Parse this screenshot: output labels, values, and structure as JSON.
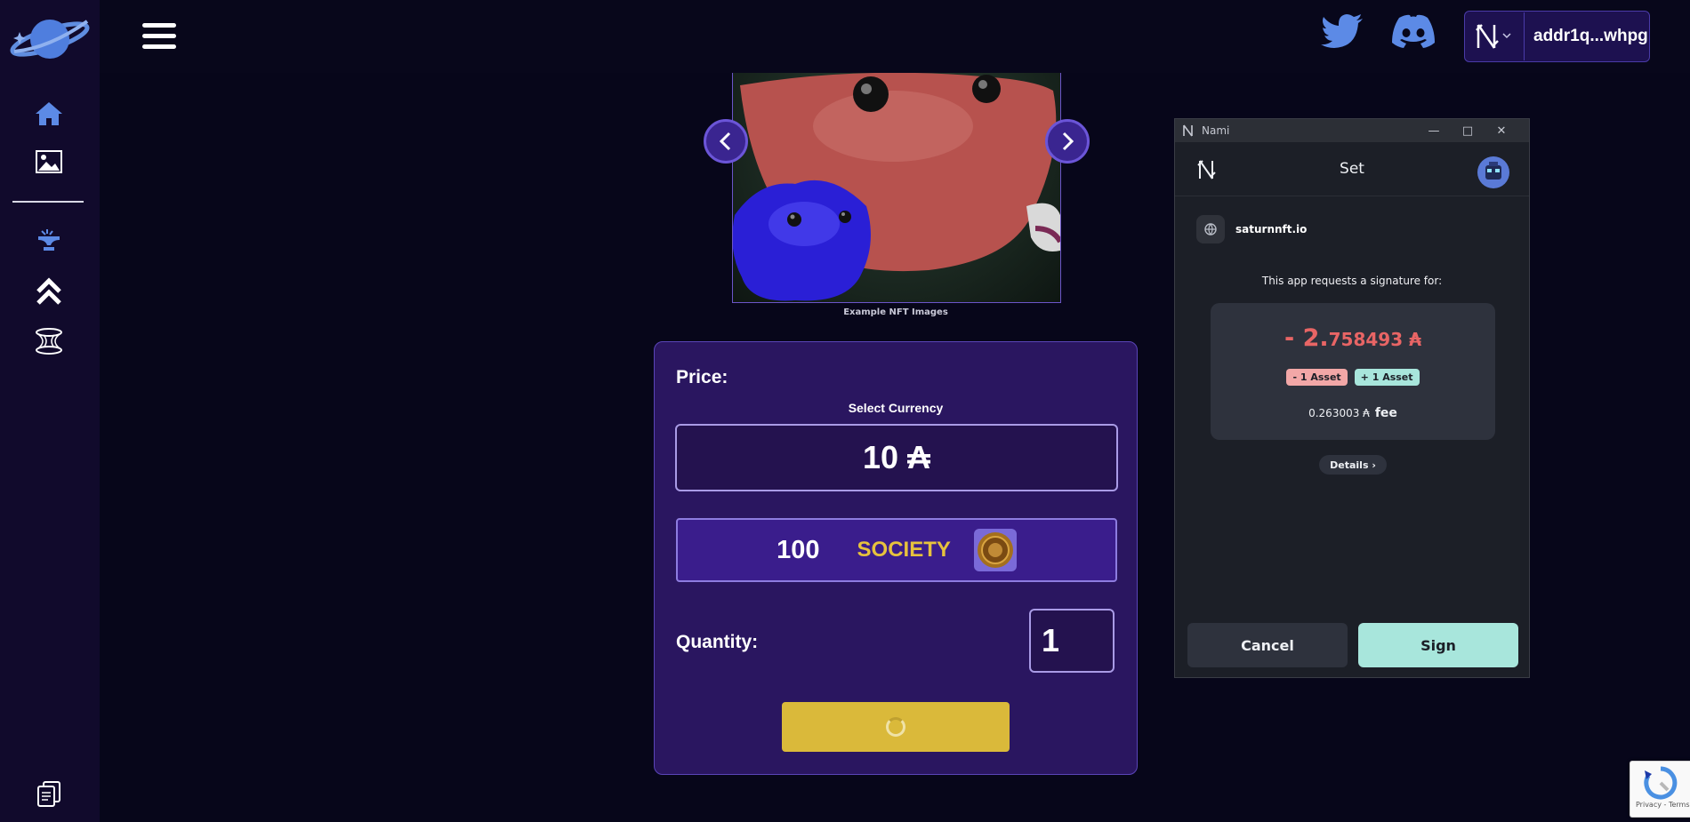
{
  "topbar": {
    "wallet_address": "addr1q...whpg"
  },
  "nft_preview": {
    "caption": "Example NFT Images"
  },
  "price_card": {
    "price_label": "Price:",
    "select_currency": "Select Currency",
    "ada_option": "10 ₳",
    "society_amount": "100",
    "society_name": "SOCIETY",
    "quantity_label": "Quantity:",
    "quantity_value": "1"
  },
  "nami": {
    "window_title": "Nami",
    "header_title": "Set",
    "site": "saturnnft.io",
    "request_text": "This app requests a signature for:",
    "amount_main": "- 2.",
    "amount_decimals": "758493 ₳",
    "badge_minus": "- 1 Asset",
    "badge_plus": "+ 1 Asset",
    "fee_value": "0.263003 ₳",
    "fee_label": "fee",
    "details_label": "Details ›",
    "cancel_label": "Cancel",
    "sign_label": "Sign"
  },
  "recaptcha": {
    "text": "Privacy - Terms"
  },
  "colors": {
    "accent": "#5a45b8",
    "society_gold": "#e7c23d",
    "sign_teal": "#a8e6dc",
    "negative_red": "#e86565"
  },
  "icons": {
    "sidebar": [
      "home-icon",
      "image-icon",
      "anvil-icon",
      "chevrons-up-icon",
      "portal-icon",
      "documents-icon"
    ],
    "topbar": [
      "menu-icon",
      "twitter-icon",
      "discord-icon",
      "nami-logo-icon"
    ]
  }
}
